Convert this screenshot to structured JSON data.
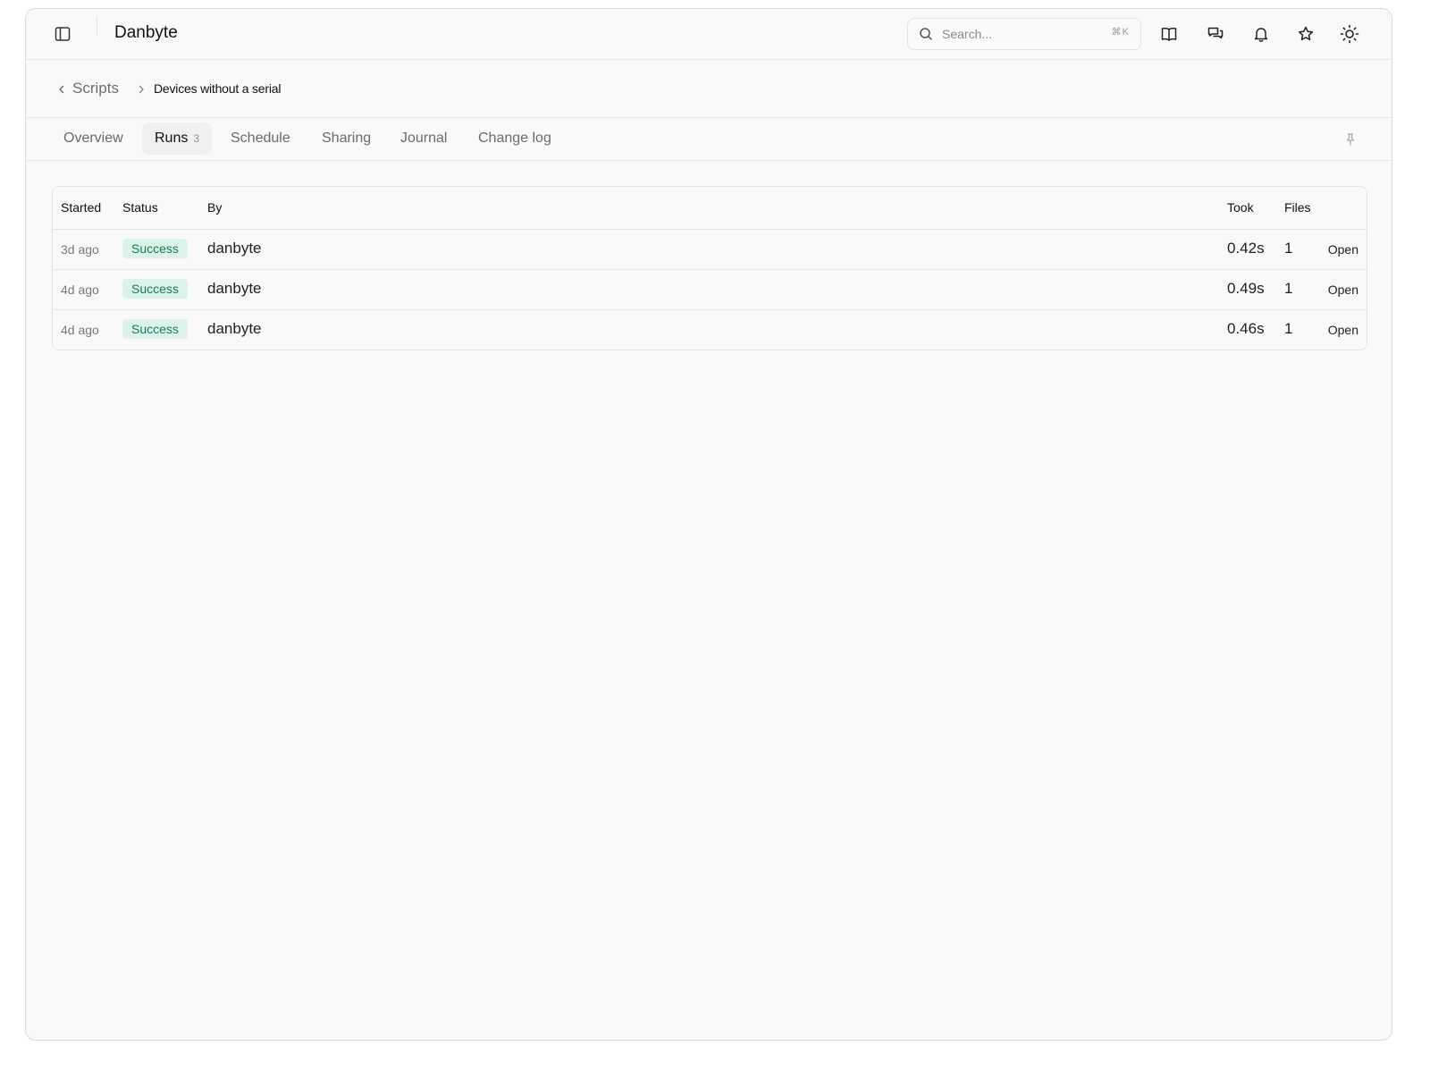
{
  "app": {
    "title": "Danbyte"
  },
  "search": {
    "placeholder": "Search...",
    "shortcut": "⌘K"
  },
  "toolbar_icons": [
    "sidebar-toggle-icon",
    "book-open-icon",
    "chat-bubbles-icon",
    "bell-icon",
    "star-icon",
    "sun-icon"
  ],
  "breadcrumb": {
    "parent": "Scripts",
    "current": "Devices without a serial"
  },
  "tabs": [
    {
      "label": "Overview"
    },
    {
      "label": "Runs",
      "count": "3"
    },
    {
      "label": "Schedule"
    },
    {
      "label": "Sharing"
    },
    {
      "label": "Journal"
    },
    {
      "label": "Change log"
    }
  ],
  "table": {
    "headers": {
      "started": "Started",
      "status": "Status",
      "by": "By",
      "took": "Took",
      "files": "Files"
    },
    "rows": [
      {
        "started": "3d ago",
        "status": "Success",
        "by": "danbyte",
        "took": "0.42s",
        "files": "1",
        "action": "Open"
      },
      {
        "started": "4d ago",
        "status": "Success",
        "by": "danbyte",
        "took": "0.49s",
        "files": "1",
        "action": "Open"
      },
      {
        "started": "4d ago",
        "status": "Success",
        "by": "danbyte",
        "took": "0.46s",
        "files": "1",
        "action": "Open"
      }
    ]
  },
  "colors": {
    "success_text": "#1a7a55",
    "success_bg": "#dcf3ea",
    "background": "#f9f9f9"
  }
}
